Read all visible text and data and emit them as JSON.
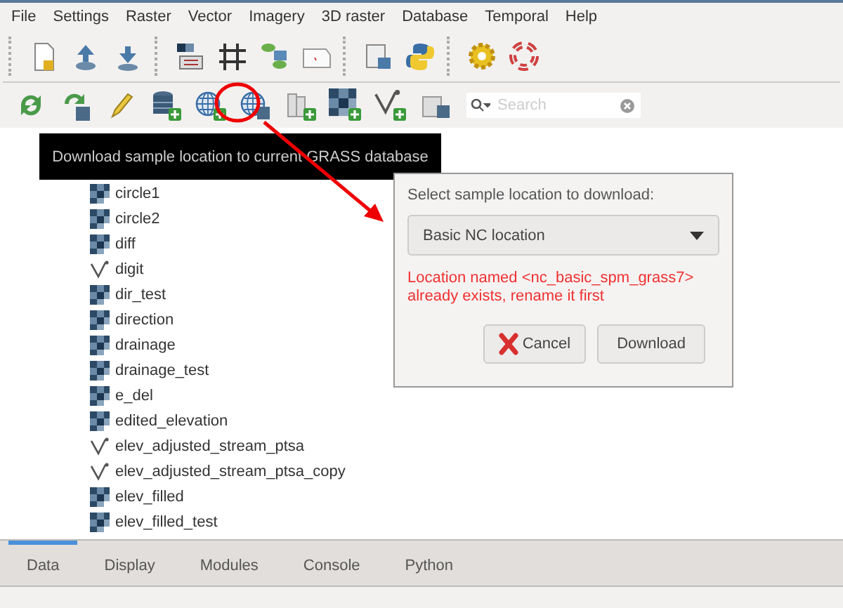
{
  "menu": [
    "File",
    "Settings",
    "Raster",
    "Vector",
    "Imagery",
    "3D raster",
    "Database",
    "Temporal",
    "Help"
  ],
  "search": {
    "placeholder": "Search"
  },
  "tooltip": "Download sample location to current GRASS database",
  "tree": [
    {
      "name": "circle1",
      "kind": "raster"
    },
    {
      "name": "circle2",
      "kind": "raster"
    },
    {
      "name": "diff",
      "kind": "raster"
    },
    {
      "name": "digit",
      "kind": "vector"
    },
    {
      "name": "dir_test",
      "kind": "raster"
    },
    {
      "name": "direction",
      "kind": "raster"
    },
    {
      "name": "drainage",
      "kind": "raster"
    },
    {
      "name": "drainage_test",
      "kind": "raster"
    },
    {
      "name": "e_del",
      "kind": "raster"
    },
    {
      "name": "edited_elevation",
      "kind": "raster"
    },
    {
      "name": "elev_adjusted_stream_ptsa",
      "kind": "vector"
    },
    {
      "name": "elev_adjusted_stream_ptsa_copy",
      "kind": "vector"
    },
    {
      "name": "elev_filled",
      "kind": "raster"
    },
    {
      "name": "elev_filled_test",
      "kind": "raster"
    }
  ],
  "dialog": {
    "label": "Select sample location to download:",
    "location": "Basic NC location",
    "error": "Location named <nc_basic_spm_grass7> already exists, rename it first",
    "buttons": [
      {
        "label": "Cancel",
        "kind": "cancel"
      },
      {
        "label": "Download",
        "kind": "plain"
      }
    ]
  },
  "tabs": [
    {
      "label": "Data",
      "selected": true
    },
    {
      "label": "Display",
      "selected": false
    },
    {
      "label": "Modules",
      "selected": false
    },
    {
      "label": "Console",
      "selected": false
    },
    {
      "label": "Python",
      "selected": false
    }
  ]
}
